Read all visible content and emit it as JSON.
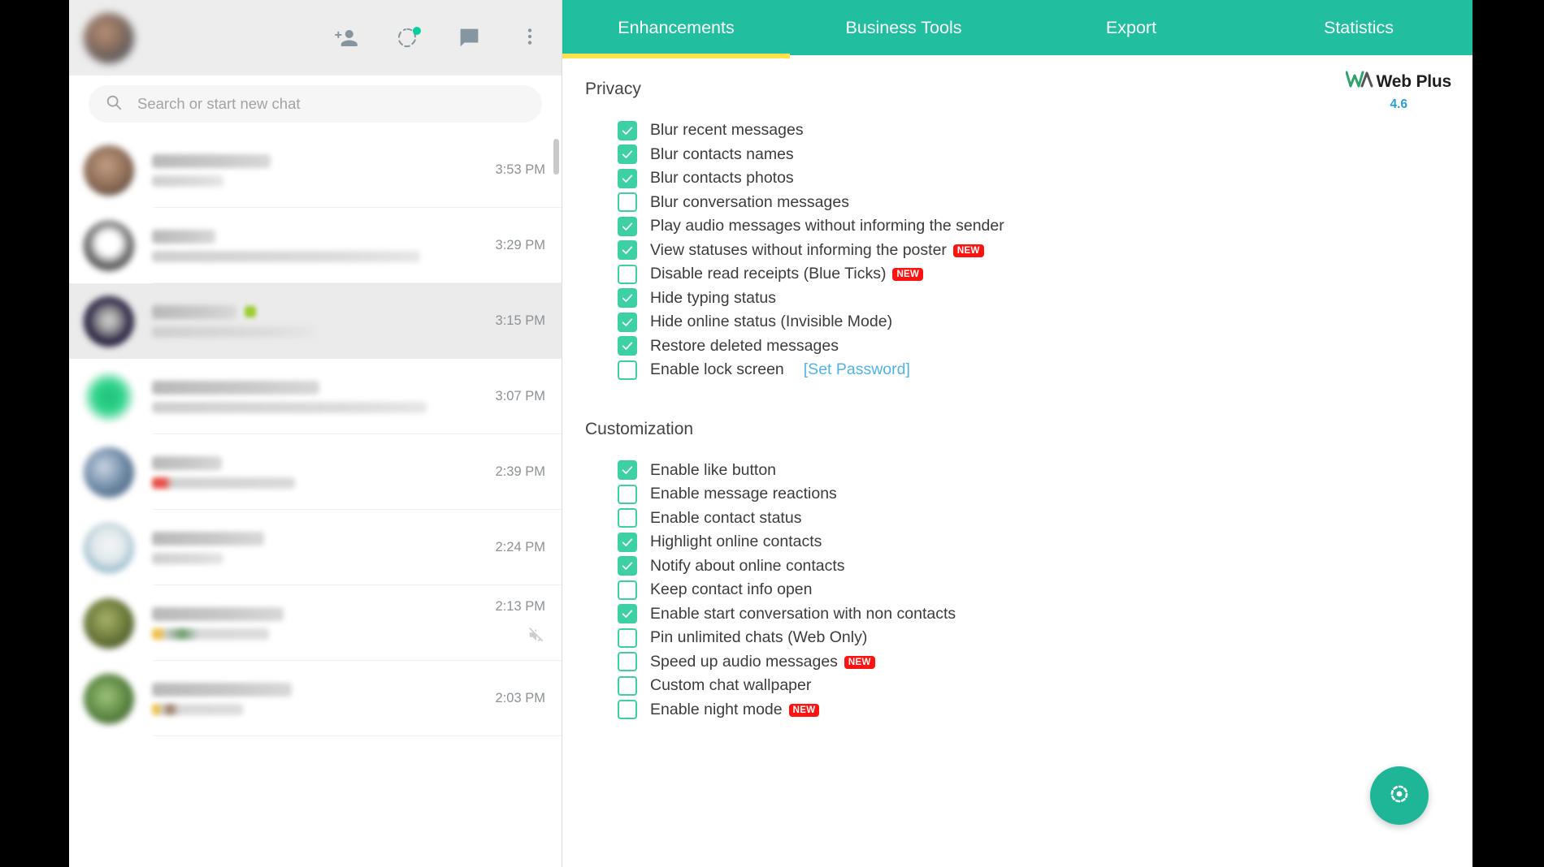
{
  "app": {
    "brand_name": "Web Plus",
    "brand_version": "4.6",
    "logo_icon": "wa-logo-icon",
    "accent_color": "#21bfa0",
    "active_tab_underline_color": "#ffe14d",
    "checkbox_color": "#3ed0a5",
    "new_badge_color": "#fe1212",
    "link_color": "#4fb3e8"
  },
  "tabs": [
    {
      "label": "Enhancements",
      "active": true
    },
    {
      "label": "Business Tools",
      "active": false
    },
    {
      "label": "Export",
      "active": false
    },
    {
      "label": "Statistics",
      "active": false
    }
  ],
  "sidebar": {
    "header_icons": [
      {
        "name": "add-person-icon"
      },
      {
        "name": "status-ring-icon",
        "has_dot": true
      },
      {
        "name": "new-chat-icon"
      },
      {
        "name": "menu-dots-icon"
      }
    ],
    "search": {
      "placeholder": "Search or start new chat",
      "value": "",
      "icon": "search-icon"
    },
    "chats": [
      {
        "time": "3:53 PM",
        "selected": false,
        "muted": false
      },
      {
        "time": "3:29 PM",
        "selected": false,
        "muted": false
      },
      {
        "time": "3:15 PM",
        "selected": true,
        "muted": false
      },
      {
        "time": "3:07 PM",
        "selected": false,
        "muted": false
      },
      {
        "time": "2:39 PM",
        "selected": false,
        "muted": false
      },
      {
        "time": "2:24 PM",
        "selected": false,
        "muted": false
      },
      {
        "time": "2:13 PM",
        "selected": false,
        "muted": true
      },
      {
        "time": "2:03 PM",
        "selected": false,
        "muted": false
      }
    ]
  },
  "sections": [
    {
      "title": "Privacy",
      "options": [
        {
          "label": "Blur recent messages",
          "checked": true,
          "badge": ""
        },
        {
          "label": "Blur contacts names",
          "checked": true,
          "badge": ""
        },
        {
          "label": "Blur contacts photos",
          "checked": true,
          "badge": ""
        },
        {
          "label": "Blur conversation messages",
          "checked": false,
          "badge": ""
        },
        {
          "label": "Play audio messages without informing the sender",
          "checked": true,
          "badge": ""
        },
        {
          "label": "View statuses without informing the poster",
          "checked": true,
          "badge": "NEW"
        },
        {
          "label": "Disable read receipts (Blue Ticks)",
          "checked": false,
          "badge": "NEW"
        },
        {
          "label": "Hide typing status",
          "checked": true,
          "badge": ""
        },
        {
          "label": "Hide online status (Invisible Mode)",
          "checked": true,
          "badge": ""
        },
        {
          "label": "Restore deleted messages",
          "checked": true,
          "badge": ""
        },
        {
          "label": "Enable lock screen",
          "checked": false,
          "badge": "",
          "link": "[Set Password]"
        }
      ]
    },
    {
      "title": "Customization",
      "options": [
        {
          "label": "Enable like button",
          "checked": true,
          "badge": ""
        },
        {
          "label": "Enable message reactions",
          "checked": false,
          "badge": ""
        },
        {
          "label": "Enable contact status",
          "checked": false,
          "badge": ""
        },
        {
          "label": "Highlight online contacts",
          "checked": true,
          "badge": ""
        },
        {
          "label": "Notify about online contacts",
          "checked": true,
          "badge": ""
        },
        {
          "label": "Keep contact info open",
          "checked": false,
          "badge": ""
        },
        {
          "label": "Enable start conversation with non contacts",
          "checked": true,
          "badge": ""
        },
        {
          "label": "Pin unlimited chats (Web Only)",
          "checked": false,
          "badge": ""
        },
        {
          "label": "Speed up audio messages",
          "checked": false,
          "badge": "NEW"
        },
        {
          "label": "Custom chat wallpaper",
          "checked": false,
          "badge": ""
        },
        {
          "label": "Enable night mode",
          "checked": false,
          "badge": "NEW"
        }
      ]
    }
  ],
  "fab": {
    "icon": "target-settings-icon"
  }
}
